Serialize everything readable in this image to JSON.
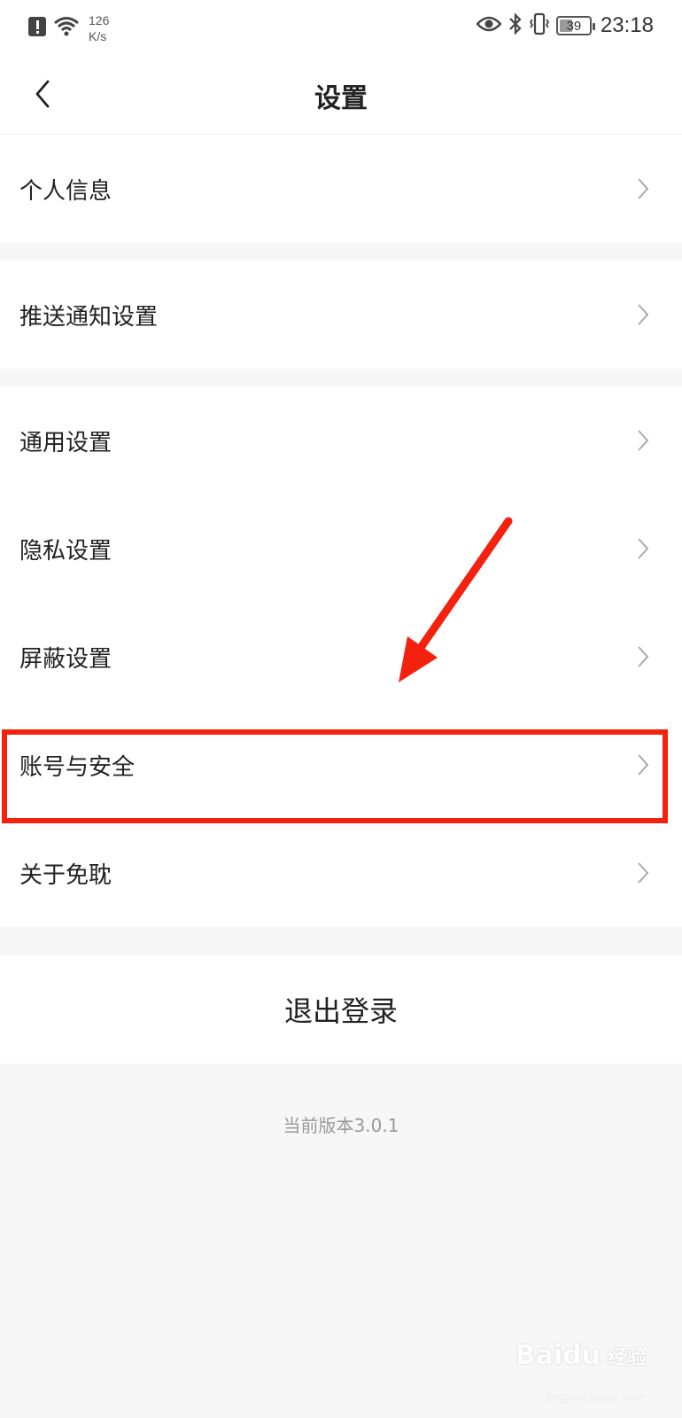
{
  "status_bar": {
    "net_speed_value": "126",
    "net_speed_unit": "K/s",
    "time": "23:18",
    "battery": "39",
    "battery_level_percent": 39,
    "icons": [
      "alert-icon",
      "wifi-icon",
      "eye-icon",
      "bluetooth-icon",
      "vibrate-icon",
      "battery-icon"
    ]
  },
  "header": {
    "title": "设置"
  },
  "groups": [
    {
      "items": [
        {
          "label": "个人信息"
        }
      ]
    },
    {
      "items": [
        {
          "label": "推送通知设置"
        }
      ]
    },
    {
      "items": [
        {
          "label": "通用设置"
        },
        {
          "label": "隐私设置"
        },
        {
          "label": "屏蔽设置"
        },
        {
          "label": "账号与安全"
        },
        {
          "label": "关于免耽"
        }
      ]
    }
  ],
  "logout_label": "退出登录",
  "version_text": "当前版本3.0.1",
  "watermark": {
    "brand": "Baidu",
    "cn": "经验",
    "sub": "jingyan.baidu.com"
  },
  "colors": {
    "highlight": "#f2220e",
    "background": "#f7f7f7"
  }
}
